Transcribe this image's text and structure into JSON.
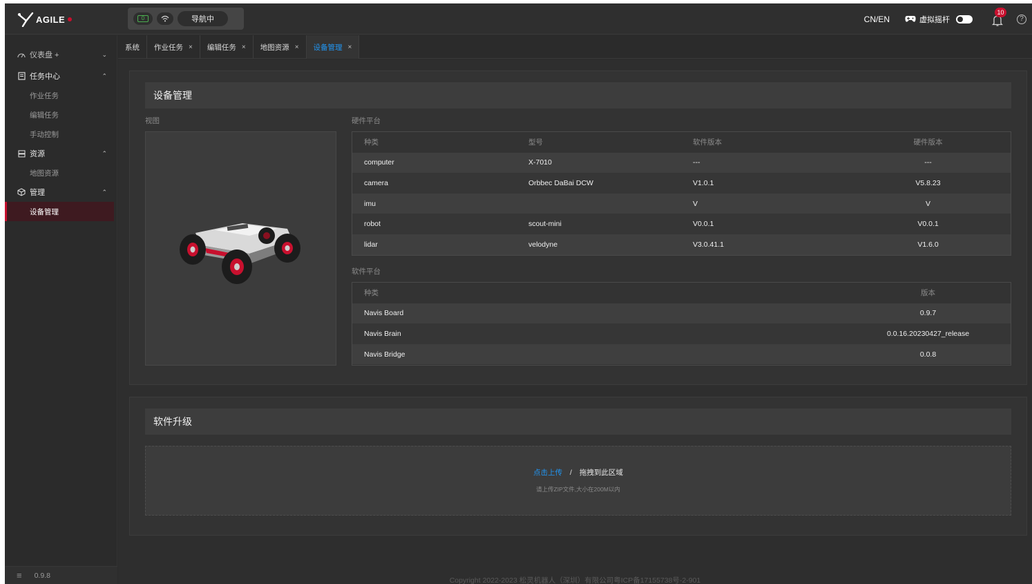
{
  "header": {
    "logo_text": "AGILE",
    "battery_value": "0",
    "nav_status": "导航中",
    "lang": "CN/EN",
    "virtual_joystick_label": "虚拟摇杆",
    "notification_count": "10",
    "help_glyph": "?"
  },
  "sidebar": {
    "dashboard": "仪表盘 +",
    "task_center": "任务中心",
    "task_items": [
      "作业任务",
      "编辑任务",
      "手动控制"
    ],
    "resources": "资源",
    "resource_items": [
      "地图资源"
    ],
    "management": "管理",
    "management_items": [
      "设备管理"
    ],
    "version": "0.9.8",
    "menu_glyph": "≡"
  },
  "tabs": [
    {
      "label": "系统",
      "closable": false
    },
    {
      "label": "作业任务",
      "closable": true
    },
    {
      "label": "编辑任务",
      "closable": true
    },
    {
      "label": "地图资源",
      "closable": true
    },
    {
      "label": "设备管理",
      "closable": true,
      "active": true
    }
  ],
  "tab_close_glyph": "×",
  "device": {
    "title": "设备管理",
    "view_label": "视图",
    "hardware_label": "硬件平台",
    "hardware_headers": [
      "种类",
      "型号",
      "软件版本",
      "硬件版本"
    ],
    "hardware_rows": [
      [
        "computer",
        "X-7010",
        "---",
        "---"
      ],
      [
        "camera",
        "Orbbec DaBai DCW",
        "V1.0.1",
        "V5.8.23"
      ],
      [
        "imu",
        "",
        "V",
        "V"
      ],
      [
        "robot",
        "scout-mini",
        "V0.0.1",
        "V0.0.1"
      ],
      [
        "lidar",
        "velodyne",
        "V3.0.41.1",
        "V1.6.0"
      ]
    ],
    "software_label": "软件平台",
    "software_headers": [
      "种类",
      "版本"
    ],
    "software_rows": [
      [
        "Navis Board",
        "0.9.7"
      ],
      [
        "Navis Brain",
        "0.0.16.20230427_release"
      ],
      [
        "Navis Bridge",
        "0.0.8"
      ]
    ]
  },
  "upgrade": {
    "title": "软件升级",
    "click_upload": "点击上传",
    "separator": "/",
    "drag_here": "拖拽到此区域",
    "hint": "请上传ZIP文件,大小在200M以内"
  },
  "footer": {
    "copyright": "Copyright 2022-2023 松灵机器人（深圳）有限公司粤ICP备17155738号-2-901"
  },
  "colors": {
    "accent": "#2196f3",
    "brand_red": "#c8102e",
    "battery_green": "#4caf50"
  },
  "icons": [
    "logo-icon",
    "battery-icon",
    "wifi-icon",
    "gamepad-icon",
    "bell-icon",
    "help-icon",
    "dashboard-icon",
    "task-icon",
    "resource-icon",
    "management-icon",
    "menu-icon",
    "close-icon",
    "chevron-icon",
    "robot-image"
  ]
}
